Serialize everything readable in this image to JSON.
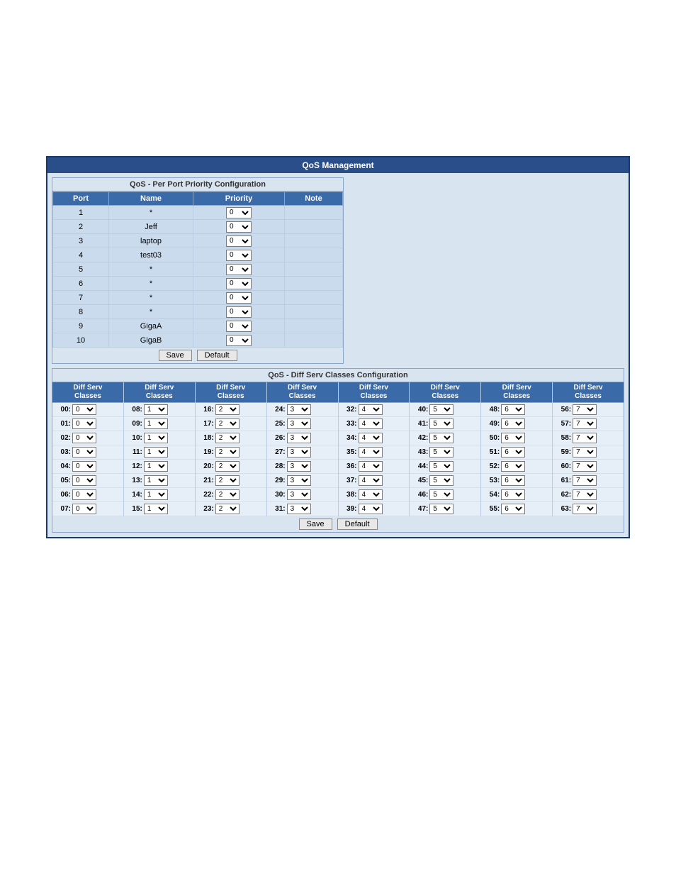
{
  "title": "QoS Management",
  "portSection": {
    "header": "QoS - Per Port Priority Configuration",
    "columns": [
      "Port",
      "Name",
      "Priority",
      "Note"
    ],
    "rows": [
      {
        "port": "1",
        "name": "*",
        "priority": "0",
        "note": ""
      },
      {
        "port": "2",
        "name": "Jeff",
        "priority": "0",
        "note": ""
      },
      {
        "port": "3",
        "name": "laptop",
        "priority": "0",
        "note": ""
      },
      {
        "port": "4",
        "name": "test03",
        "priority": "0",
        "note": ""
      },
      {
        "port": "5",
        "name": "*",
        "priority": "0",
        "note": ""
      },
      {
        "port": "6",
        "name": "*",
        "priority": "0",
        "note": ""
      },
      {
        "port": "7",
        "name": "*",
        "priority": "0",
        "note": ""
      },
      {
        "port": "8",
        "name": "*",
        "priority": "0",
        "note": ""
      },
      {
        "port": "9",
        "name": "GigaA",
        "priority": "0",
        "note": ""
      },
      {
        "port": "10",
        "name": "GigaB",
        "priority": "0",
        "note": ""
      }
    ],
    "buttons": {
      "save": "Save",
      "default": "Default"
    }
  },
  "diffSection": {
    "header": "QoS - Diff Serv Classes Configuration",
    "colHeader": "Diff Serv Classes",
    "columns": [
      [
        {
          "id": "00",
          "v": "0"
        },
        {
          "id": "01",
          "v": "0"
        },
        {
          "id": "02",
          "v": "0"
        },
        {
          "id": "03",
          "v": "0"
        },
        {
          "id": "04",
          "v": "0"
        },
        {
          "id": "05",
          "v": "0"
        },
        {
          "id": "06",
          "v": "0"
        },
        {
          "id": "07",
          "v": "0"
        }
      ],
      [
        {
          "id": "08",
          "v": "1"
        },
        {
          "id": "09",
          "v": "1"
        },
        {
          "id": "10",
          "v": "1"
        },
        {
          "id": "11",
          "v": "1"
        },
        {
          "id": "12",
          "v": "1"
        },
        {
          "id": "13",
          "v": "1"
        },
        {
          "id": "14",
          "v": "1"
        },
        {
          "id": "15",
          "v": "1"
        }
      ],
      [
        {
          "id": "16",
          "v": "2"
        },
        {
          "id": "17",
          "v": "2"
        },
        {
          "id": "18",
          "v": "2"
        },
        {
          "id": "19",
          "v": "2"
        },
        {
          "id": "20",
          "v": "2"
        },
        {
          "id": "21",
          "v": "2"
        },
        {
          "id": "22",
          "v": "2"
        },
        {
          "id": "23",
          "v": "2"
        }
      ],
      [
        {
          "id": "24",
          "v": "3"
        },
        {
          "id": "25",
          "v": "3"
        },
        {
          "id": "26",
          "v": "3"
        },
        {
          "id": "27",
          "v": "3"
        },
        {
          "id": "28",
          "v": "3"
        },
        {
          "id": "29",
          "v": "3"
        },
        {
          "id": "30",
          "v": "3"
        },
        {
          "id": "31",
          "v": "3"
        }
      ],
      [
        {
          "id": "32",
          "v": "4"
        },
        {
          "id": "33",
          "v": "4"
        },
        {
          "id": "34",
          "v": "4"
        },
        {
          "id": "35",
          "v": "4"
        },
        {
          "id": "36",
          "v": "4"
        },
        {
          "id": "37",
          "v": "4"
        },
        {
          "id": "38",
          "v": "4"
        },
        {
          "id": "39",
          "v": "4"
        }
      ],
      [
        {
          "id": "40",
          "v": "5"
        },
        {
          "id": "41",
          "v": "5"
        },
        {
          "id": "42",
          "v": "5"
        },
        {
          "id": "43",
          "v": "5"
        },
        {
          "id": "44",
          "v": "5"
        },
        {
          "id": "45",
          "v": "5"
        },
        {
          "id": "46",
          "v": "5"
        },
        {
          "id": "47",
          "v": "5"
        }
      ],
      [
        {
          "id": "48",
          "v": "6"
        },
        {
          "id": "49",
          "v": "6"
        },
        {
          "id": "50",
          "v": "6"
        },
        {
          "id": "51",
          "v": "6"
        },
        {
          "id": "52",
          "v": "6"
        },
        {
          "id": "53",
          "v": "6"
        },
        {
          "id": "54",
          "v": "6"
        },
        {
          "id": "55",
          "v": "6"
        }
      ],
      [
        {
          "id": "56",
          "v": "7"
        },
        {
          "id": "57",
          "v": "7"
        },
        {
          "id": "58",
          "v": "7"
        },
        {
          "id": "59",
          "v": "7"
        },
        {
          "id": "60",
          "v": "7"
        },
        {
          "id": "61",
          "v": "7"
        },
        {
          "id": "62",
          "v": "7"
        },
        {
          "id": "63",
          "v": "7"
        }
      ]
    ],
    "buttons": {
      "save": "Save",
      "default": "Default"
    }
  }
}
